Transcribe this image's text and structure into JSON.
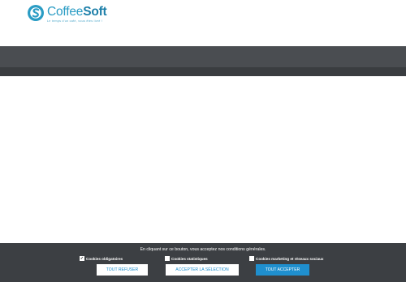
{
  "brand": {
    "name_part1": "Coffee",
    "name_part2": "Soft",
    "tagline": "Le temps d'un café, vous êtes livré !",
    "colors": {
      "primary": "#2a9cc4",
      "dark": "#1d7fa9"
    }
  },
  "cookie_banner": {
    "message": "En cliquant sur ce bouton, vous acceptez nos conditions générales.",
    "options": [
      {
        "label": "Cookies obligatoires",
        "checked": true
      },
      {
        "label": "Cookies statistiques",
        "checked": false
      },
      {
        "label": "Cookies marketing et réseaux sociaux",
        "checked": false
      }
    ],
    "buttons": {
      "refuse": "TOUT REFUSER",
      "accept_selection": "ACCEPTER LA SÉLECTION",
      "accept_all": "TOUT ACCEPTER"
    },
    "colors": {
      "accent": "#1f8fce",
      "background": "#3c3f43"
    }
  }
}
